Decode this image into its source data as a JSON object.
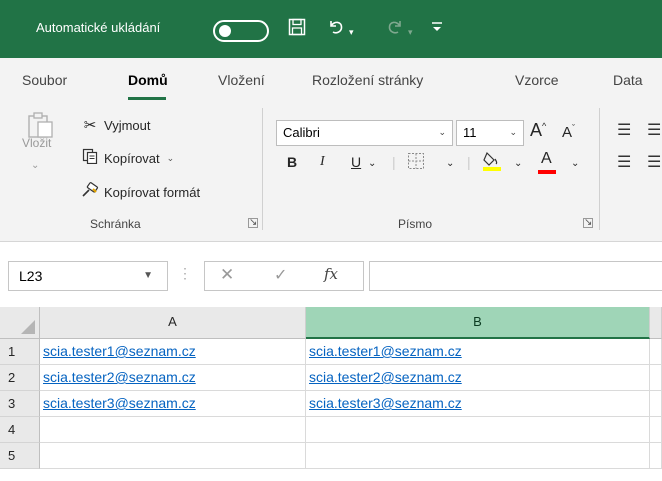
{
  "titlebar": {
    "autosave_label": "Automatické ukládání",
    "autosave_toggle": "Vypnuto",
    "accent": "#217346"
  },
  "tabs": [
    {
      "label": "Soubor",
      "active": false
    },
    {
      "label": "Domů",
      "active": true
    },
    {
      "label": "Vložení",
      "active": false
    },
    {
      "label": "Rozložení stránky",
      "active": false
    },
    {
      "label": "Vzorce",
      "active": false
    },
    {
      "label": "Data",
      "active": false
    }
  ],
  "ribbon": {
    "clipboard": {
      "paste_label": "Vložit",
      "cut_label": "Vyjmout",
      "copy_label": "Kopírovat",
      "format_painter_label": "Kopírovat formát",
      "group_label": "Schránka"
    },
    "font": {
      "font_name": "Calibri",
      "font_size": "11",
      "bold": "B",
      "italic": "I",
      "underline": "U",
      "font_color_letter": "A",
      "grow_font": "A",
      "shrink_font": "A",
      "group_label": "Písmo",
      "highlight_color": "#ffff00",
      "font_color": "#ff0000"
    }
  },
  "formula_bar": {
    "name_box": "L23",
    "fx_label": "fx",
    "formula": ""
  },
  "sheet": {
    "columns": [
      {
        "label": "A",
        "selected": false
      },
      {
        "label": "B",
        "selected": true
      }
    ],
    "rows": [
      {
        "num": "1",
        "cells": [
          "scia.tester1@seznam.cz",
          "scia.tester1@seznam.cz"
        ]
      },
      {
        "num": "2",
        "cells": [
          "scia.tester2@seznam.cz",
          "scia.tester2@seznam.cz"
        ]
      },
      {
        "num": "3",
        "cells": [
          "scia.tester3@seznam.cz",
          "scia.tester3@seznam.cz"
        ]
      },
      {
        "num": "4",
        "cells": [
          "",
          ""
        ]
      },
      {
        "num": "5",
        "cells": [
          "",
          ""
        ]
      }
    ],
    "link_color": "#0563c1",
    "selected_header_color": "#9fd5b7"
  }
}
